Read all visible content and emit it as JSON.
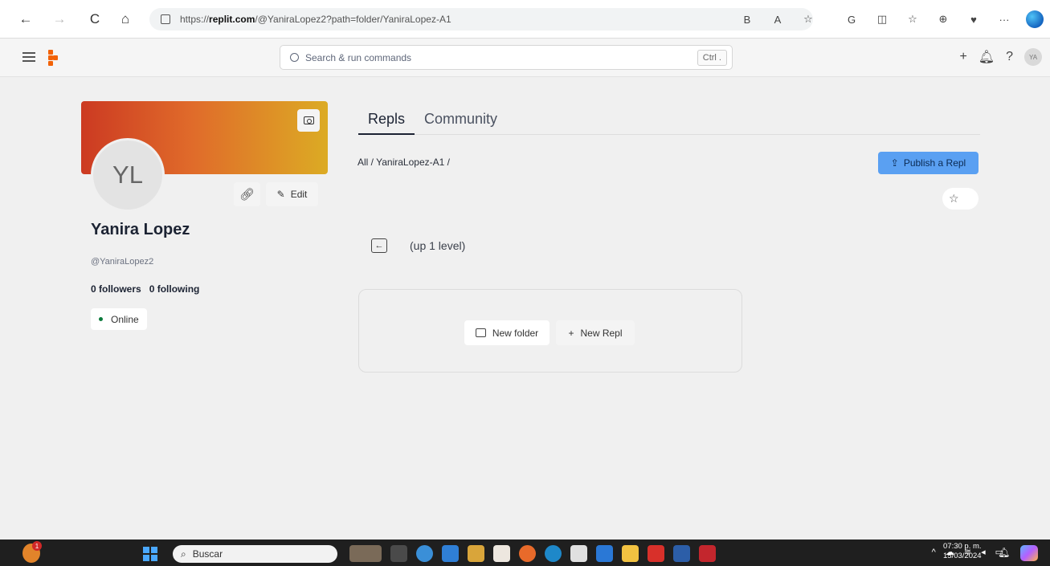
{
  "browser": {
    "url_prefix": "https://",
    "url_domain": "replit.com",
    "url_path": "/@YaniraLopez2?path=folder/YaniraLopez-A1",
    "back": "←",
    "forward": "→",
    "reload": "C",
    "home": "⌂",
    "toolbar_icons": [
      "B",
      "A",
      "☆",
      "G",
      "◫",
      "☆",
      "⊕",
      "♥",
      "···"
    ]
  },
  "header": {
    "search_placeholder": "Search & run commands",
    "shortcut": "Ctrl .",
    "add": "+",
    "bell": "♫",
    "help": "?",
    "user_initials": "YA"
  },
  "profile": {
    "initials": "YL",
    "name": "Yanira Lopez",
    "handle": "@YaniraLopez2",
    "followers": "0 followers",
    "following": "0 following",
    "status": "Online",
    "edit_label": "Edit"
  },
  "main": {
    "tabs": [
      {
        "label": "Repls",
        "active": true
      },
      {
        "label": "Community",
        "active": false
      }
    ],
    "breadcrumb": "All / YaniraLopez-A1 /",
    "publish_label": "Publish a Repl",
    "up_label": "(up 1 level)",
    "new_folder_label": "New folder",
    "new_repl_label": "New Repl"
  },
  "taskbar": {
    "search_label": "Buscar",
    "time": "07:30 p. m.",
    "date": "15/03/2024",
    "widget_badge": "1"
  },
  "colors": {
    "accent": "#5aa0f2",
    "banner_start": "#cc3a22",
    "banner_end": "#dcab24",
    "online": "#0a7a3b",
    "replit_orange": "#f26207"
  }
}
